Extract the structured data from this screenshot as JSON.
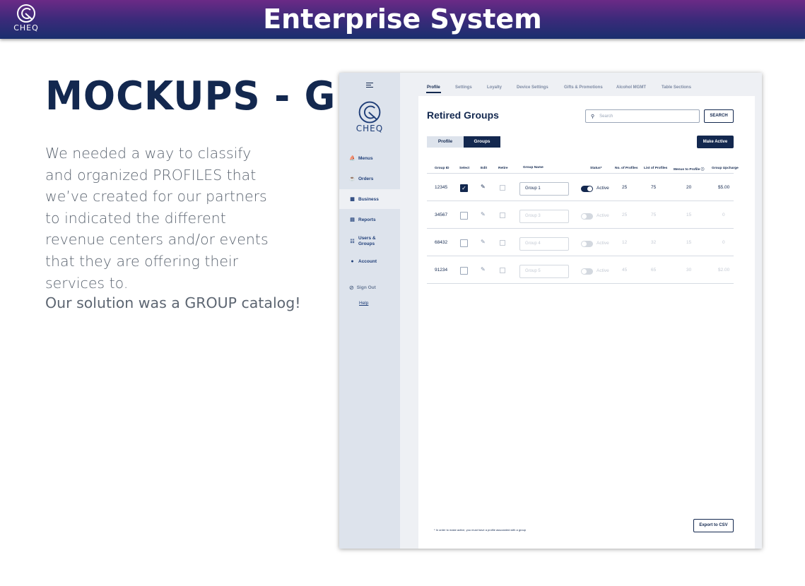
{
  "banner": {
    "logo_text": "CHEQ",
    "title": "Enterprise System"
  },
  "slide": {
    "heading": "MOCKUPS - GROUP",
    "paragraph": "We needed a way to classify and organized PROFILES that we’ve created for our partners to indicated the different revenue centers and/or events that they are offering their services to.",
    "conclusion": "Our solution was a GROUP catalog!"
  },
  "app": {
    "logo_text": "CHEQ",
    "sidebar": {
      "items": [
        {
          "label": "Menus",
          "icon": "boat-icon"
        },
        {
          "label": "Orders",
          "icon": "cup-icon"
        },
        {
          "label": "Business",
          "icon": "store-icon",
          "active": true
        },
        {
          "label": "Reports",
          "icon": "chart-icon"
        },
        {
          "label": "Users & Groups",
          "icon": "users-icon"
        },
        {
          "label": "Account",
          "icon": "person-icon"
        }
      ],
      "sign_out": "Sign Out",
      "help": "Help"
    },
    "tabs": [
      "Profile",
      "Settings",
      "Loyalty",
      "Device Settings",
      "Gifts & Promotions",
      "Alcohol MGMT",
      "Table Sections"
    ],
    "active_tab": "Profile",
    "page_title": "Retired Groups",
    "search": {
      "placeholder": "Search",
      "button": "SEARCH"
    },
    "segment": {
      "left": "Profile",
      "right": "Groups",
      "selected": "Groups"
    },
    "make_active_button": "Make Active",
    "table": {
      "headers": [
        "Group ID",
        "Select",
        "Edit",
        "Retire",
        "Group Name",
        "Status*",
        "No. of Profiles",
        "List of Profiles",
        "Menus to Profile",
        "Group Upcharge"
      ],
      "rows": [
        {
          "id": "12345",
          "selected": true,
          "name": "Group 1",
          "status": "Active",
          "active": true,
          "profiles": "25",
          "list": "75",
          "menus": "20",
          "upcharge": "$5.00"
        },
        {
          "id": "34567",
          "selected": false,
          "name": "Group 3",
          "status": "Active",
          "active": false,
          "profiles": "25",
          "list": "75",
          "menus": "15",
          "upcharge": "0"
        },
        {
          "id": "68432",
          "selected": false,
          "name": "Group 4",
          "status": "Active",
          "active": false,
          "profiles": "12",
          "list": "32",
          "menus": "15",
          "upcharge": "0"
        },
        {
          "id": "91234",
          "selected": false,
          "name": "Group 5",
          "status": "Active",
          "active": false,
          "profiles": "45",
          "list": "65",
          "menus": "30",
          "upcharge": "$2.00"
        }
      ]
    },
    "footnote": "* In order to make active, you must have a profile associated with a group",
    "export_button": "Export to CSV"
  },
  "colors": {
    "navy": "#13284f",
    "banner_start": "#6b2a86",
    "banner_end": "#1a2f6e",
    "sidebar": "#dde3ec",
    "body_text": "#5d6672"
  }
}
